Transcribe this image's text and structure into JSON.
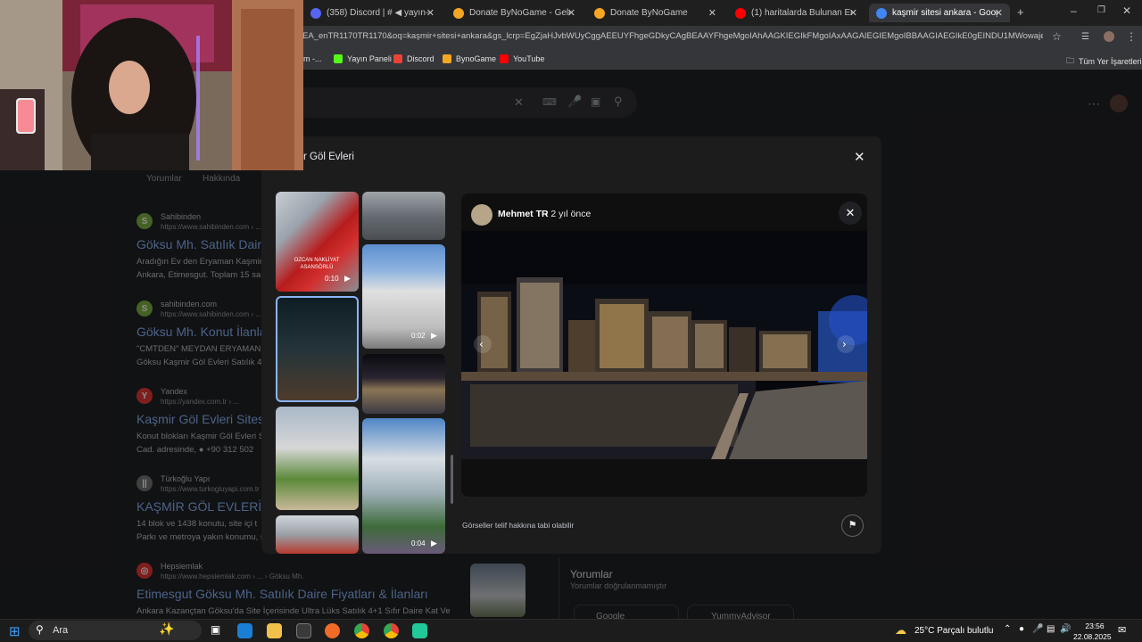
{
  "browser": {
    "tabs": [
      {
        "label": "(358) Discord | # ◀ yayın-duyu",
        "color": "#5865f2",
        "active": false
      },
      {
        "label": "Donate ByNoGame - Gelen/Gid",
        "color": "#f5a623",
        "active": false
      },
      {
        "label": "Donate ByNoGame",
        "color": "#f5a623",
        "active": false
      },
      {
        "label": "(1) haritalarda Bulunan En Tuha",
        "color": "#ff0000",
        "active": false
      },
      {
        "label": "kaşmir sitesi ankara - Google'd",
        "color": "#4285f4",
        "active": true
      }
    ],
    "new_tab": "+",
    "url": "EA_enTR1170TR1170&oq=kaşmir+sitesi+ankara&gs_lcrp=EgZjaHJvbWUyCggAEEUYFhgeGDkyCAgBEAAYFhgeMgoIAhAAGKIEGIkFMgoIAxAAGAIEGIEMgoIBBAAGIAEGIkE0gEINDU1MWowajeoAgCwA...",
    "bookmarks": [
      {
        "label": "m -..."
      },
      {
        "label": "Yayın Paneli",
        "color": "#53fc18"
      },
      {
        "label": "Discord",
        "color": "#ea4335"
      },
      {
        "label": "BynoGame",
        "color": "#f5a623"
      },
      {
        "label": "YouTube",
        "color": "#ff0000"
      }
    ],
    "bookmarks_all": "Tüm Yer İşaretleri"
  },
  "search": {
    "tabs": [
      "Yorumlar",
      "Hakkında"
    ],
    "results": [
      {
        "site": "Sahibinden",
        "url": "https://www.sahibinden.com › ...",
        "title": "Göksu Mh. Satılık Daire",
        "snippet": [
          "Aradığın Ev den Eryaman Kaşmir",
          "Ankara, Etimesgut. Toplam 15 sa"
        ],
        "fav": "S",
        "favcolor": "#7cb342"
      },
      {
        "site": "sahibinden.com",
        "url": "https://www.sahibinden.com › ...",
        "title": "Göksu Mh. Konut İlanla",
        "snippet": [
          "\"CMTDEN\" MEYDAN ERYAMAN",
          "Göksu Kaşmir Göl Evleri Satılık 4"
        ],
        "fav": "S",
        "favcolor": "#7cb342"
      },
      {
        "site": "Yandex",
        "url": "https://yandex.com.tr › ...",
        "title": "Kaşmir Göl Evleri Sitesi",
        "snippet": [
          "Konut blokları Kaşmir Göl Evleri S",
          "Cad. adresinde, ● +90 312 502"
        ],
        "fav": "Y",
        "favcolor": "#e53935"
      },
      {
        "site": "Türkoğlu Yapı",
        "url": "https://www.turkogluyapi.com.tr",
        "title": "KAŞMİR GÖL EVLERİ",
        "snippet": [
          "14 blok ve 1438 konutu, site içi t",
          "Parkı ve metroya yakın konumu, s"
        ],
        "fav": "||",
        "favcolor": "#757575"
      },
      {
        "site": "Hepsiemlak",
        "url": "https://www.hepsiemlak.com › ... › Göksu Mh.",
        "title": "Etimesgut Göksu Mh. Satılık Daire Fiyatları & İlanları",
        "snippet": [
          "Ankara Kazançtan Göksu'da Site İçerisinde Ultra Lüks Satılık 4+1 Sıfır Daire Kat Ve"
        ],
        "fav": "◎",
        "favcolor": "#e53935"
      }
    ],
    "reviews_title": "Yorumlar",
    "reviews_sub": "Yorumlar doğrulanmamıştır",
    "review_sources": [
      "Google",
      "YummyAdvisor"
    ]
  },
  "modal": {
    "title": "r Göl Evleri",
    "poster": "Mehmet TR",
    "time": "· 2 yıl önce",
    "thumb_labels": [
      "OZCAN NAKLİYAT ASANSÖRLÜ",
      "0:10",
      "0:02",
      "0:04"
    ],
    "copyright": "Görseller telif hakkına tabi olabilir"
  },
  "taskbar": {
    "search": "Ara",
    "weather": "25°C  Parçalı bulutlu",
    "time": "23:56",
    "date": "22.08.2025"
  }
}
